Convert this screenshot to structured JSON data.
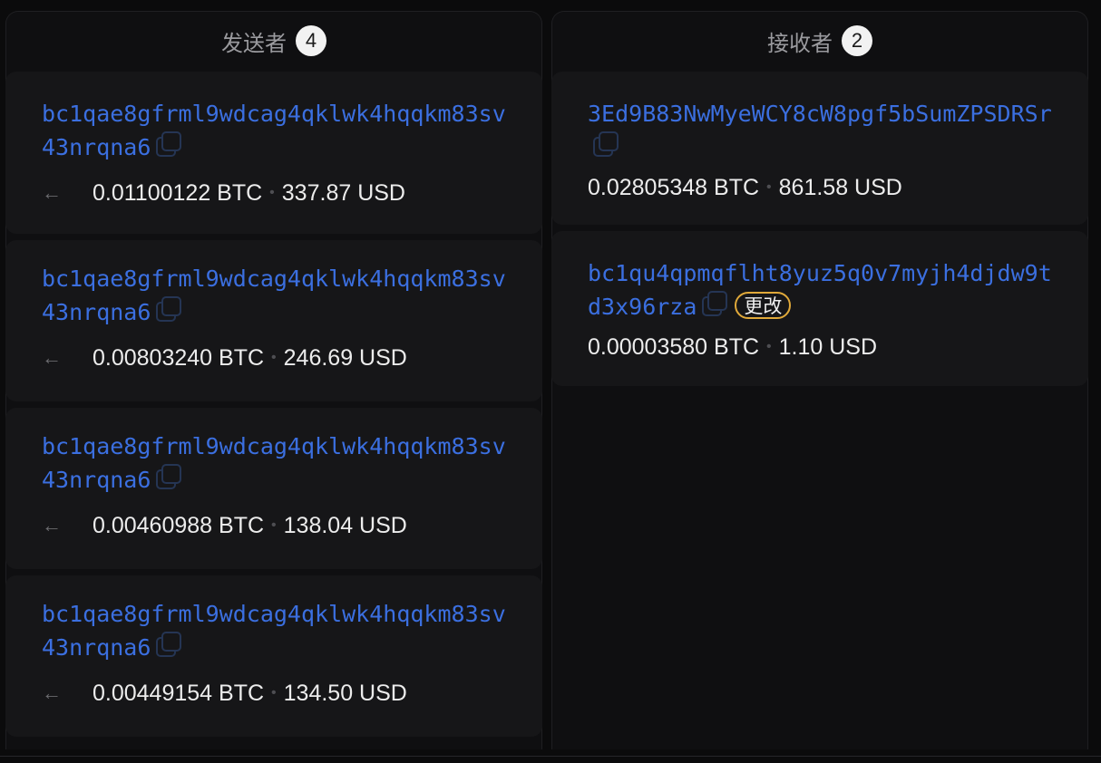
{
  "senders": {
    "title": "发送者",
    "count": "4",
    "items": [
      {
        "address": "bc1qae8gfrml9wdcag4qklwk4hqqkm83sv43nrqna6",
        "btc": "0.01100122 BTC",
        "usd": "337.87 USD",
        "arrow": "←"
      },
      {
        "address": "bc1qae8gfrml9wdcag4qklwk4hqqkm83sv43nrqna6",
        "btc": "0.00803240 BTC",
        "usd": "246.69 USD",
        "arrow": "←"
      },
      {
        "address": "bc1qae8gfrml9wdcag4qklwk4hqqkm83sv43nrqna6",
        "btc": "0.00460988 BTC",
        "usd": "138.04 USD",
        "arrow": "←"
      },
      {
        "address": "bc1qae8gfrml9wdcag4qklwk4hqqkm83sv43nrqna6",
        "btc": "0.00449154 BTC",
        "usd": "134.50 USD",
        "arrow": "←"
      }
    ]
  },
  "receivers": {
    "title": "接收者",
    "count": "2",
    "items": [
      {
        "address": "3Ed9B83NwMyeWCY8cW8pgf5bSumZPSDRSr",
        "btc": "0.02805348 BTC",
        "usd": "861.58 USD"
      },
      {
        "address": "bc1qu4qpmqflht8yuz5q0v7myjh4djdw9td3x96rza",
        "btc": "0.00003580 BTC",
        "usd": "1.10 USD",
        "badge": "更改"
      }
    ]
  },
  "separator": "•",
  "colors": {
    "address": "#3b6fe0",
    "change_badge_border": "#e0a93a",
    "card_bg": "#161618"
  },
  "icons": {
    "copy": "copy-icon",
    "arrow": "arrow-left-icon"
  }
}
